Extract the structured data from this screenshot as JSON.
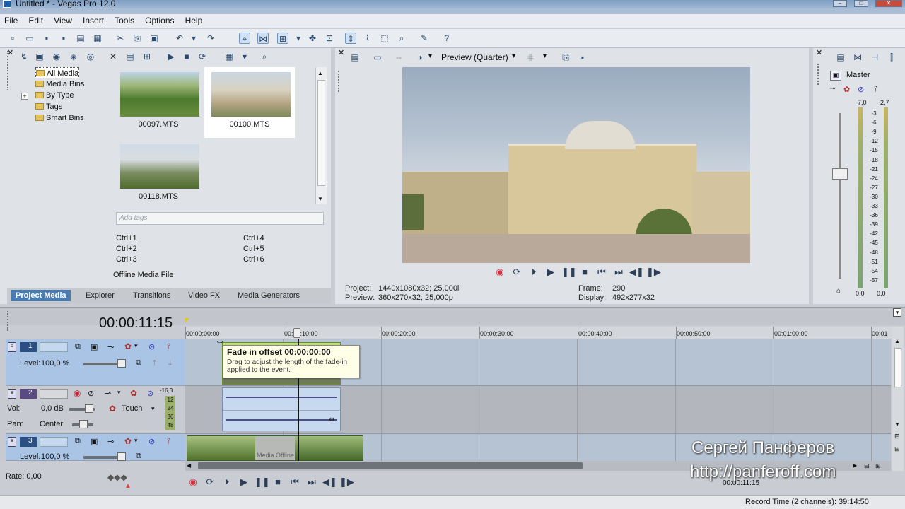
{
  "window": {
    "title": "Untitled * - Vegas Pro 12.0"
  },
  "menu": [
    "File",
    "Edit",
    "View",
    "Insert",
    "Tools",
    "Options",
    "Help"
  ],
  "media": {
    "tree": [
      "All Media",
      "Media Bins",
      "By Type",
      "Tags",
      "Smart Bins"
    ],
    "tree_expand": "+",
    "thumbnails": [
      "00097.MTS",
      "00100.MTS",
      "00118.MTS"
    ],
    "tags_placeholder": "Add tags",
    "shortcuts": [
      "Ctrl+1",
      "Ctrl+2",
      "Ctrl+3",
      "Ctrl+4",
      "Ctrl+5",
      "Ctrl+6"
    ],
    "status": "Offline Media File",
    "tabs": [
      "Project Media",
      "Explorer",
      "Transitions",
      "Video FX",
      "Media Generators"
    ]
  },
  "preview": {
    "quality": "Preview (Quarter)",
    "project_label": "Project:",
    "project_value": "1440x1080x32; 25,000i",
    "preview_label": "Preview:",
    "preview_value": "360x270x32; 25,000p",
    "frame_label": "Frame:",
    "frame_value": "290",
    "display_label": "Display:",
    "display_value": "492x277x32"
  },
  "master": {
    "title": "Master",
    "peak_left": "-7,0",
    "peak_right": "-2,7",
    "scale": [
      "3",
      "6",
      "9",
      "12",
      "15",
      "18",
      "21",
      "24",
      "27",
      "30",
      "33",
      "36",
      "39",
      "42",
      "45",
      "48",
      "51",
      "54",
      "57"
    ],
    "readout_left": "0,0",
    "readout_right": "0,0"
  },
  "timeline": {
    "timecode": "00:00:11:15",
    "ruler": [
      "00:00:00:00",
      "00:00:10:00",
      "00:00:20:00",
      "00:00:30:00",
      "00:00:40:00",
      "00:00:50:00",
      "00:01:00:00",
      "00:01"
    ],
    "tracks": [
      {
        "number": "1",
        "level_label": "Level:",
        "level_value": "100,0 %"
      },
      {
        "number": "2",
        "vol_label": "Vol:",
        "vol_value": "0,0 dB",
        "pan_label": "Pan:",
        "pan_value": "Center",
        "automation": "Touch",
        "meter_top": "-16,3",
        "meter_scale": [
          "12",
          "24",
          "36",
          "48"
        ]
      },
      {
        "number": "3",
        "level_label": "Level:",
        "level_value": "100,0 %"
      }
    ],
    "event_label": "Media Offline",
    "tooltip_title": "Fade in offset 00:00:00:00",
    "tooltip_body": "Drag to adjust the length of the fade-in applied to the event."
  },
  "transport": {
    "rate": "Rate: 0,00",
    "cursor_time": "00:00:11:15"
  },
  "status": {
    "record_time": "Record Time (2 channels): 39:14:50"
  },
  "watermark": {
    "name": "Сергей Панферов",
    "url": "http://panferoff.com"
  },
  "colors": {
    "selected_tab": "#4a7bb0",
    "track_video": "#a9c4e4",
    "track_audio": "#c7cbd1",
    "event_audio": "#c7d9ef",
    "record": "#d03040"
  }
}
